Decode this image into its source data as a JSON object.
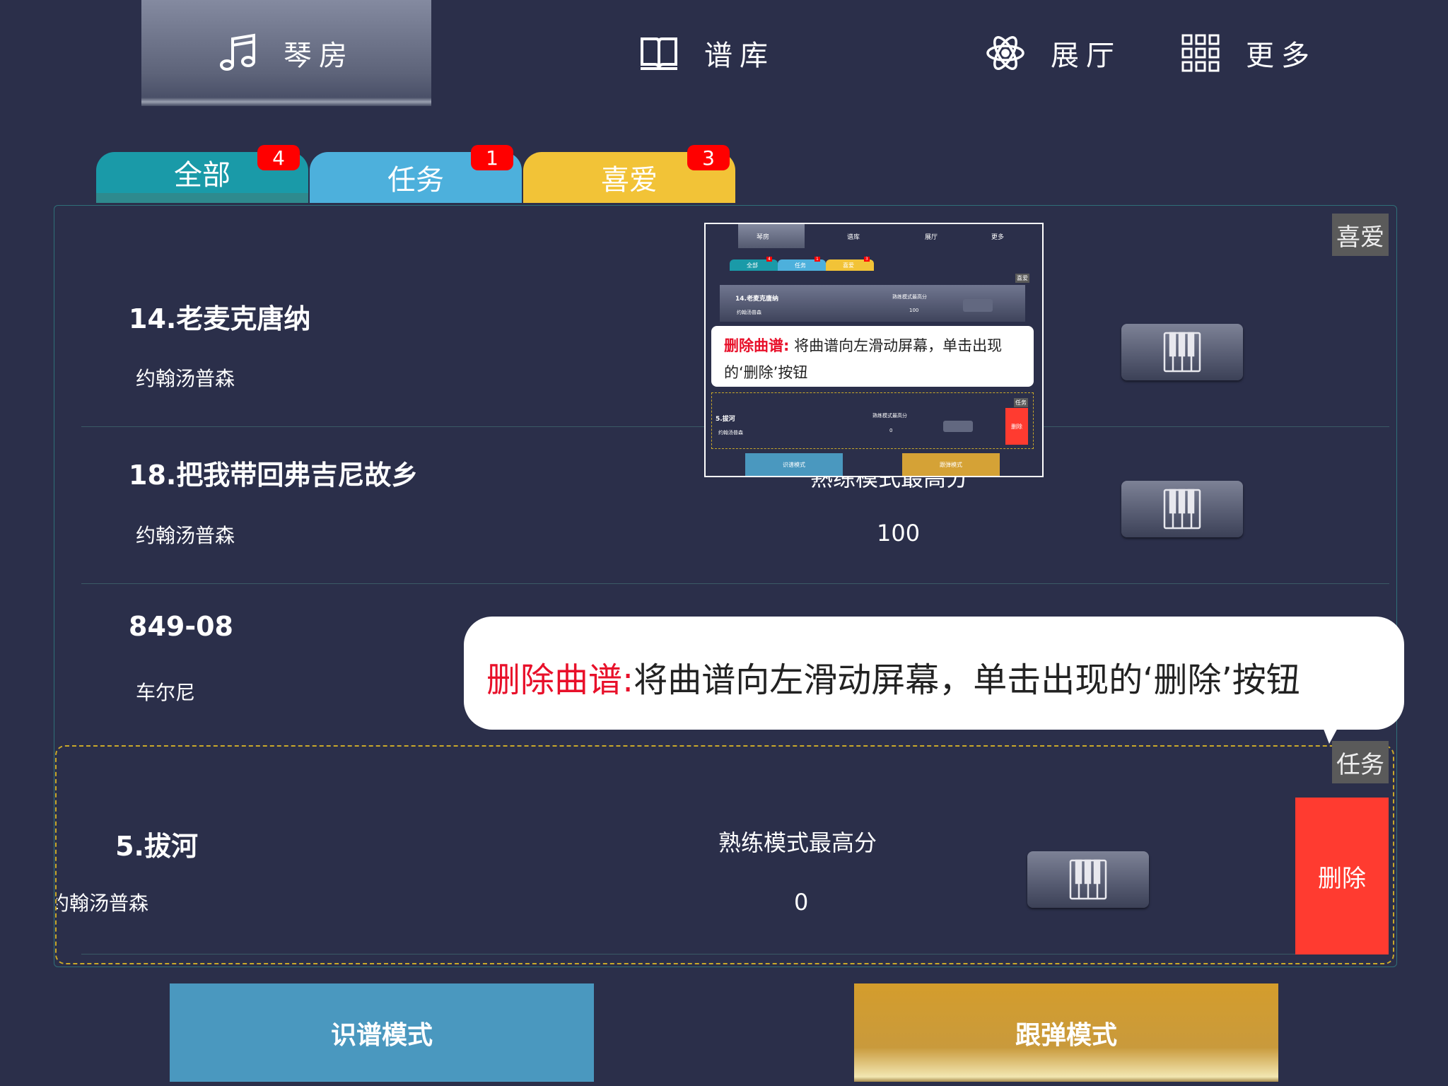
{
  "nav": {
    "items": [
      {
        "label": "琴房",
        "icon": "music-note-icon",
        "active": true
      },
      {
        "label": "谱库",
        "icon": "book-icon",
        "active": false
      },
      {
        "label": "展厅",
        "icon": "atom-icon",
        "active": false
      },
      {
        "label": "更多",
        "icon": "grid-icon",
        "active": false
      }
    ]
  },
  "tabs": [
    {
      "label": "全部",
      "badge": "4",
      "color": "#1a9aa8"
    },
    {
      "label": "任务",
      "badge": "1",
      "color": "#4db0dc"
    },
    {
      "label": "喜爱",
      "badge": "3",
      "color": "#f2c337"
    }
  ],
  "list": {
    "rows": [
      {
        "title": "14.老麦克唐纳",
        "composer": "约翰汤普森",
        "score_label": "",
        "score": "",
        "tag": "喜爱"
      },
      {
        "title": "18.把我带回弗吉尼故乡",
        "composer": "约翰汤普森",
        "score_label": "熟练模式最高分",
        "score": "100",
        "tag": ""
      },
      {
        "title": "849-08",
        "composer": "车尔尼",
        "score_label": "",
        "score": "",
        "tag": ""
      },
      {
        "title": "5.拔河",
        "composer": "约翰汤普森",
        "score_label": "熟练模式最高分",
        "score": "0",
        "tag": "任务"
      }
    ],
    "delete_label": "删除"
  },
  "tooltip": {
    "title": "删除曲谱:",
    "text": "将曲谱向左滑动屏幕，单击出现的‘删除’按钮",
    "mini_title": "删除曲谱:",
    "mini_text_1": " 将曲谱向左滑动屏幕，单击出现",
    "mini_text_2": "的‘删除’按钮"
  },
  "mini": {
    "nav": [
      "琴房",
      "谱库",
      "展厅",
      "更多"
    ],
    "tabs": [
      "全部",
      "任务",
      "喜爱"
    ],
    "badges": [
      "4",
      "1",
      "3"
    ],
    "tag_top": "喜爱",
    "row1_title": "14.老麦克唐纳",
    "row1_composer": "约翰汤普森",
    "row1_label": "熟练模式最高分",
    "row1_score": "100",
    "row2_title": "5.拔河",
    "row2_composer": "约翰汤普森",
    "row2_label": "熟练模式最高分",
    "row2_score": "0",
    "tag_task": "任务",
    "delete": "删除",
    "btn_left": "识谱模式",
    "btn_right": "跟弹模式"
  },
  "modes": {
    "left": "识谱模式",
    "right": "跟弹模式"
  },
  "colors": {
    "background": "#2b2f4a",
    "delete": "#ff3b30",
    "highlight": "#e8102a",
    "mode_left": "#4a98bf",
    "mode_right": "#d5a236"
  }
}
